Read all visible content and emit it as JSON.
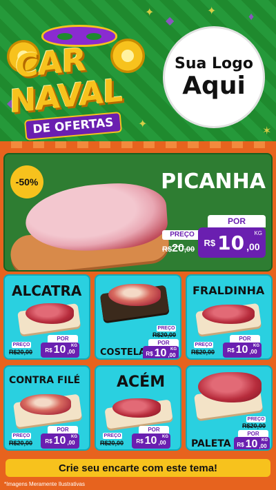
{
  "header": {
    "brand_line1": "CAR",
    "brand_line2": "NAVAL",
    "brand_ribbon": "DE OFERTAS",
    "logo_placeholder_line1": "Sua Logo",
    "logo_placeholder_line2": "Aqui"
  },
  "hero": {
    "discount": "-50%",
    "title": "PICANHA",
    "preco_label": "PREÇO",
    "old_price": "R$20,00",
    "old_price_int": "20",
    "old_price_dec": ",00",
    "por_label": "POR",
    "currency": "R$",
    "price_int": "10",
    "price_dec": ",00",
    "unit": "KG"
  },
  "products": [
    {
      "name": "ALCATRA",
      "preco_label": "PREÇO",
      "old_price": "R$20,00",
      "por_label": "POR",
      "currency": "R$",
      "price_int": "10",
      "price_dec": ",00",
      "unit": "KG"
    },
    {
      "name": "COSTELA",
      "preco_label": "PREÇO",
      "old_price": "R$20,00",
      "por_label": "POR",
      "currency": "R$",
      "price_int": "10",
      "price_dec": ",00",
      "unit": "KG"
    },
    {
      "name": "FRALDINHA",
      "preco_label": "PREÇO",
      "old_price": "R$20,00",
      "por_label": "POR",
      "currency": "R$",
      "price_int": "10",
      "price_dec": ",00",
      "unit": "KG"
    },
    {
      "name": "CONTRA FILÉ",
      "preco_label": "PREÇO",
      "old_price": "R$20,00",
      "por_label": "POR",
      "currency": "R$",
      "price_int": "10",
      "price_dec": ",00",
      "unit": "KG"
    },
    {
      "name": "ACÉM",
      "preco_label": "PREÇO",
      "old_price": "R$20,00",
      "por_label": "POR",
      "currency": "R$",
      "price_int": "10",
      "price_dec": ",00",
      "unit": "KG"
    },
    {
      "name": "PALETA",
      "preco_label": "PREÇO",
      "old_price": "R$20,00",
      "por_label": "POR",
      "currency": "R$",
      "price_int": "10",
      "price_dec": ",00",
      "unit": "KG"
    }
  ],
  "cta": "Crie seu encarte com este tema!",
  "footnote": "*Imagens Meramente Ilustrativas",
  "colors": {
    "green": "#2e7d32",
    "purple": "#6a1fb0",
    "yellow": "#f7c21d",
    "cyan": "#2ad0e0",
    "orange": "#e7631e"
  }
}
